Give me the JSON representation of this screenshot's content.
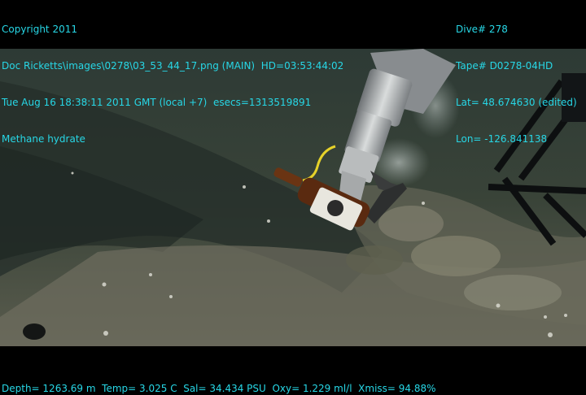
{
  "overlay": {
    "top_left": [
      "Copyright 2011",
      "Doc Ricketts\\images\\0278\\03_53_44_17.png (MAIN)  HD=03:53:44:02",
      "Tue Aug 16 18:38:11 2011 GMT (local +7)  esecs=1313519891",
      "Methane hydrate"
    ],
    "top_right": [
      "Dive# 278",
      "Tape# D0278-04HD",
      "Lat= 48.674630 (edited)",
      "Lon= -126.841138"
    ],
    "bottom": "Depth= 1263.69 m  Temp= 3.025 C  Sal= 34.434 PSU  Oxy= 1.229 ml/l  Xmiss= 94.88%"
  },
  "colors": {
    "overlay_text": "#27d7e6",
    "background": "#000000"
  }
}
